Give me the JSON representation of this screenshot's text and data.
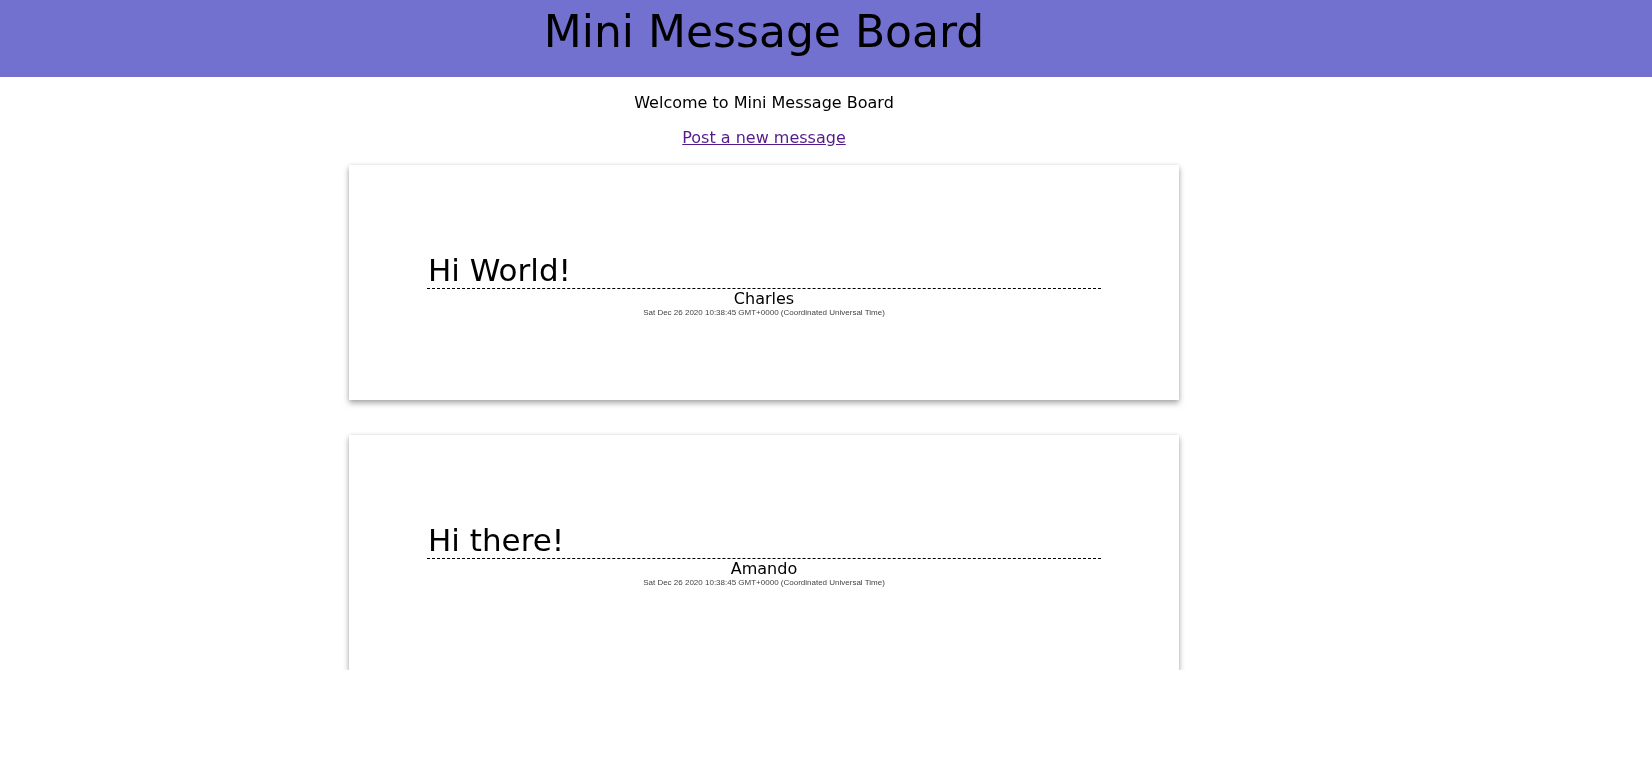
{
  "header": {
    "title": "Mini Message Board"
  },
  "intro": {
    "welcome": "Welcome to Mini Message Board",
    "new_message_link": "Post a new message"
  },
  "messages": [
    {
      "text": "Hi World!",
      "user": "Charles",
      "added": "Sat Dec 26 2020 10:38:45 GMT+0000 (Coordinated Universal Time)"
    },
    {
      "text": "Hi there!",
      "user": "Amando",
      "added": "Sat Dec 26 2020 10:38:45 GMT+0000 (Coordinated Universal Time)"
    }
  ]
}
